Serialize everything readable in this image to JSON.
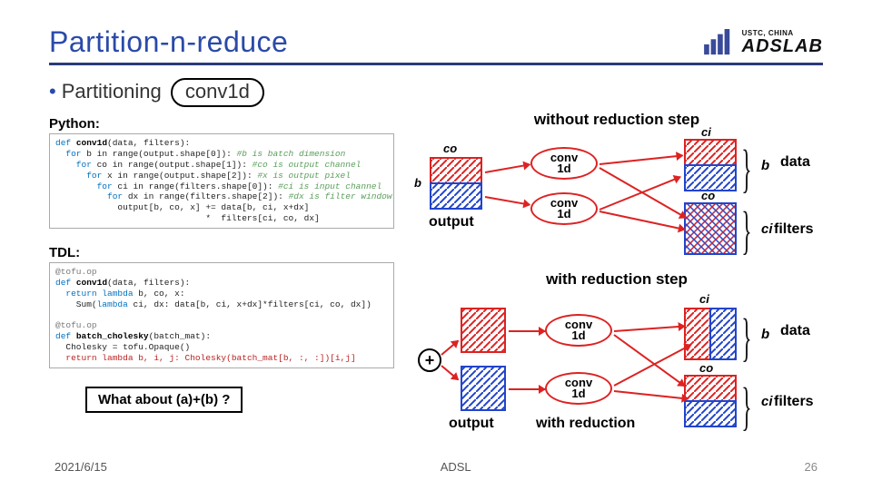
{
  "title": "Partition-n-reduce",
  "logo": {
    "sub": "USTC, CHINA",
    "main": "ADSLAB"
  },
  "bullet": {
    "lead": "Partitioning",
    "ring": "conv1d"
  },
  "labels": {
    "python": "Python:",
    "tdl": "TDL:",
    "without": "without reduction step",
    "with": "with reduction step"
  },
  "code_python": {
    "l1a": "def ",
    "l1b": "conv1d",
    "l1c": "(data, filters):",
    "l2a": "  for ",
    "l2b": "b in range(output.shape[0]): ",
    "l2c": "#b is batch dimension",
    "l3a": "    for ",
    "l3b": "co in range(output.shape[1]): ",
    "l3c": "#co is output channel",
    "l4a": "      for ",
    "l4b": "x in range(output.shape[2]): ",
    "l4c": "#x is output pixel",
    "l5a": "        for ",
    "l5b": "ci in range(filters.shape[0]): ",
    "l5c": "#ci is input channel",
    "l6a": "          for ",
    "l6b": "dx in range(filters.shape[2]): ",
    "l6c": "#dx is filter window",
    "l7": "            output[b, co, x] += data[b, ci, x+dx]",
    "l8": "                             *  filters[ci, co, dx]"
  },
  "code_tdl": {
    "l1": "@tofu.op",
    "l2a": "def ",
    "l2b": "conv1d",
    "l2c": "(data, filters):",
    "l3a": "  return lambda ",
    "l3b": "b, co, x:",
    "l4a": "    Sum(",
    "l4b": "lambda ",
    "l4c": "ci, dx: data[b, ci, x+dx]*filters[ci, co, dx])",
    "l5": "",
    "l6": "@tofu.op",
    "l7a": "def ",
    "l7b": "batch_cholesky",
    "l7c": "(batch_mat):",
    "l8": "  Cholesky = tofu.Opaque()",
    "l9a": "  return lambda ",
    "l9b": "b, i, j: Cholesky(batch_mat[b, :, :])[i,j]"
  },
  "diagram_labels": {
    "output": "output",
    "data": "data",
    "filters": "filters",
    "withred": "with reduction",
    "b": "b",
    "co": "co",
    "ci": "ci",
    "conv": "conv",
    "oned": "1d"
  },
  "question": "What about (a)+(b) ?",
  "footer": {
    "date": "2021/6/15",
    "center": "ADSL",
    "page": "26"
  }
}
